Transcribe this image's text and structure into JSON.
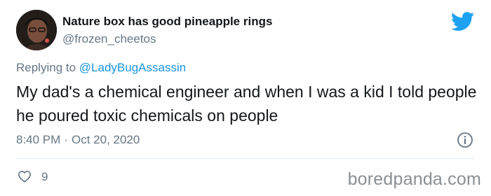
{
  "tweet": {
    "display_name": "Nature box has good pineapple rings",
    "handle": "@frozen_cheetos",
    "replying_prefix": "Replying to",
    "replying_to": "@LadyBugAssassin",
    "text": "My dad's a chemical engineer and when I was a kid I told people he poured toxic chemicals on people",
    "time": "8:40 PM",
    "separator": "·",
    "date": "Oct 20, 2020",
    "like_count": "9"
  },
  "icons": {
    "brand": "twitter-bird-icon",
    "info": "info-icon",
    "like": "heart-icon"
  },
  "colors": {
    "brand": "#1da1f2",
    "mention": "#1b95e0",
    "secondary_text": "#657786",
    "primary_text": "#14171a"
  },
  "watermark": "boredpanda.com"
}
